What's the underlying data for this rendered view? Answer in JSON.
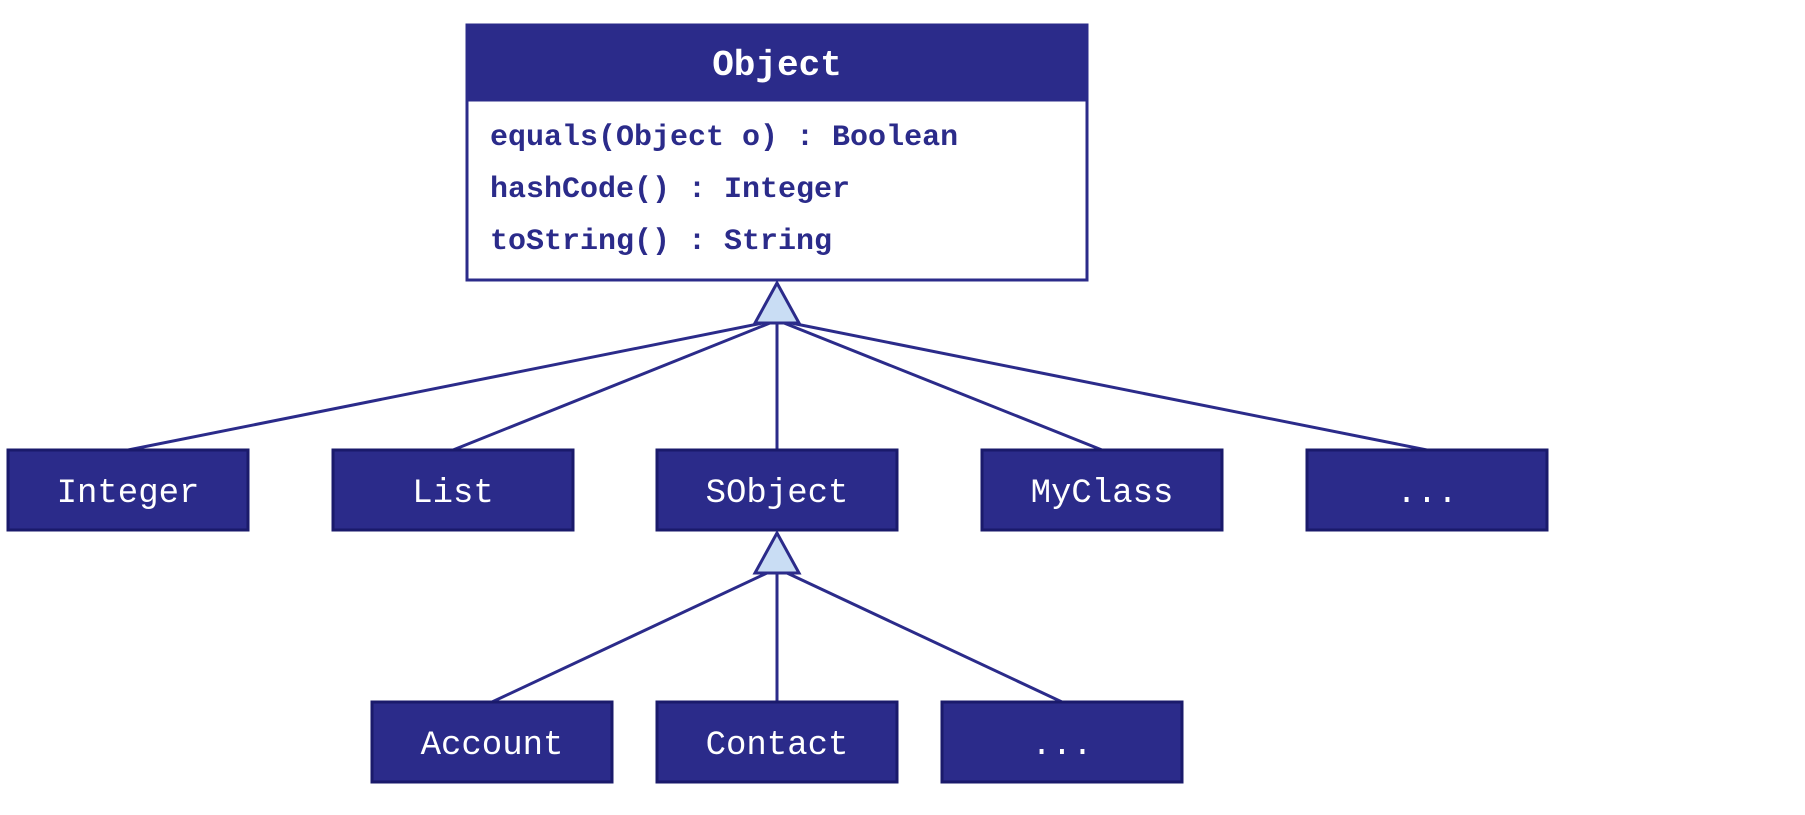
{
  "root": {
    "name": "Object",
    "methods": [
      "equals(Object o) : Boolean",
      "hashCode() : Integer",
      "toString() : String"
    ]
  },
  "children_level1": [
    {
      "label": "Integer"
    },
    {
      "label": "List"
    },
    {
      "label": "SObject"
    },
    {
      "label": "MyClass"
    },
    {
      "label": "..."
    }
  ],
  "children_level2_parent": "SObject",
  "children_level2": [
    {
      "label": "Account"
    },
    {
      "label": "Contact"
    },
    {
      "label": "..."
    }
  ],
  "colors": {
    "box_fill": "#2b2b8a",
    "box_stroke": "#1a1a6b",
    "triangle_fill": "#c9ddf4",
    "text_light": "#ffffff",
    "text_dark": "#2b2b8a"
  }
}
